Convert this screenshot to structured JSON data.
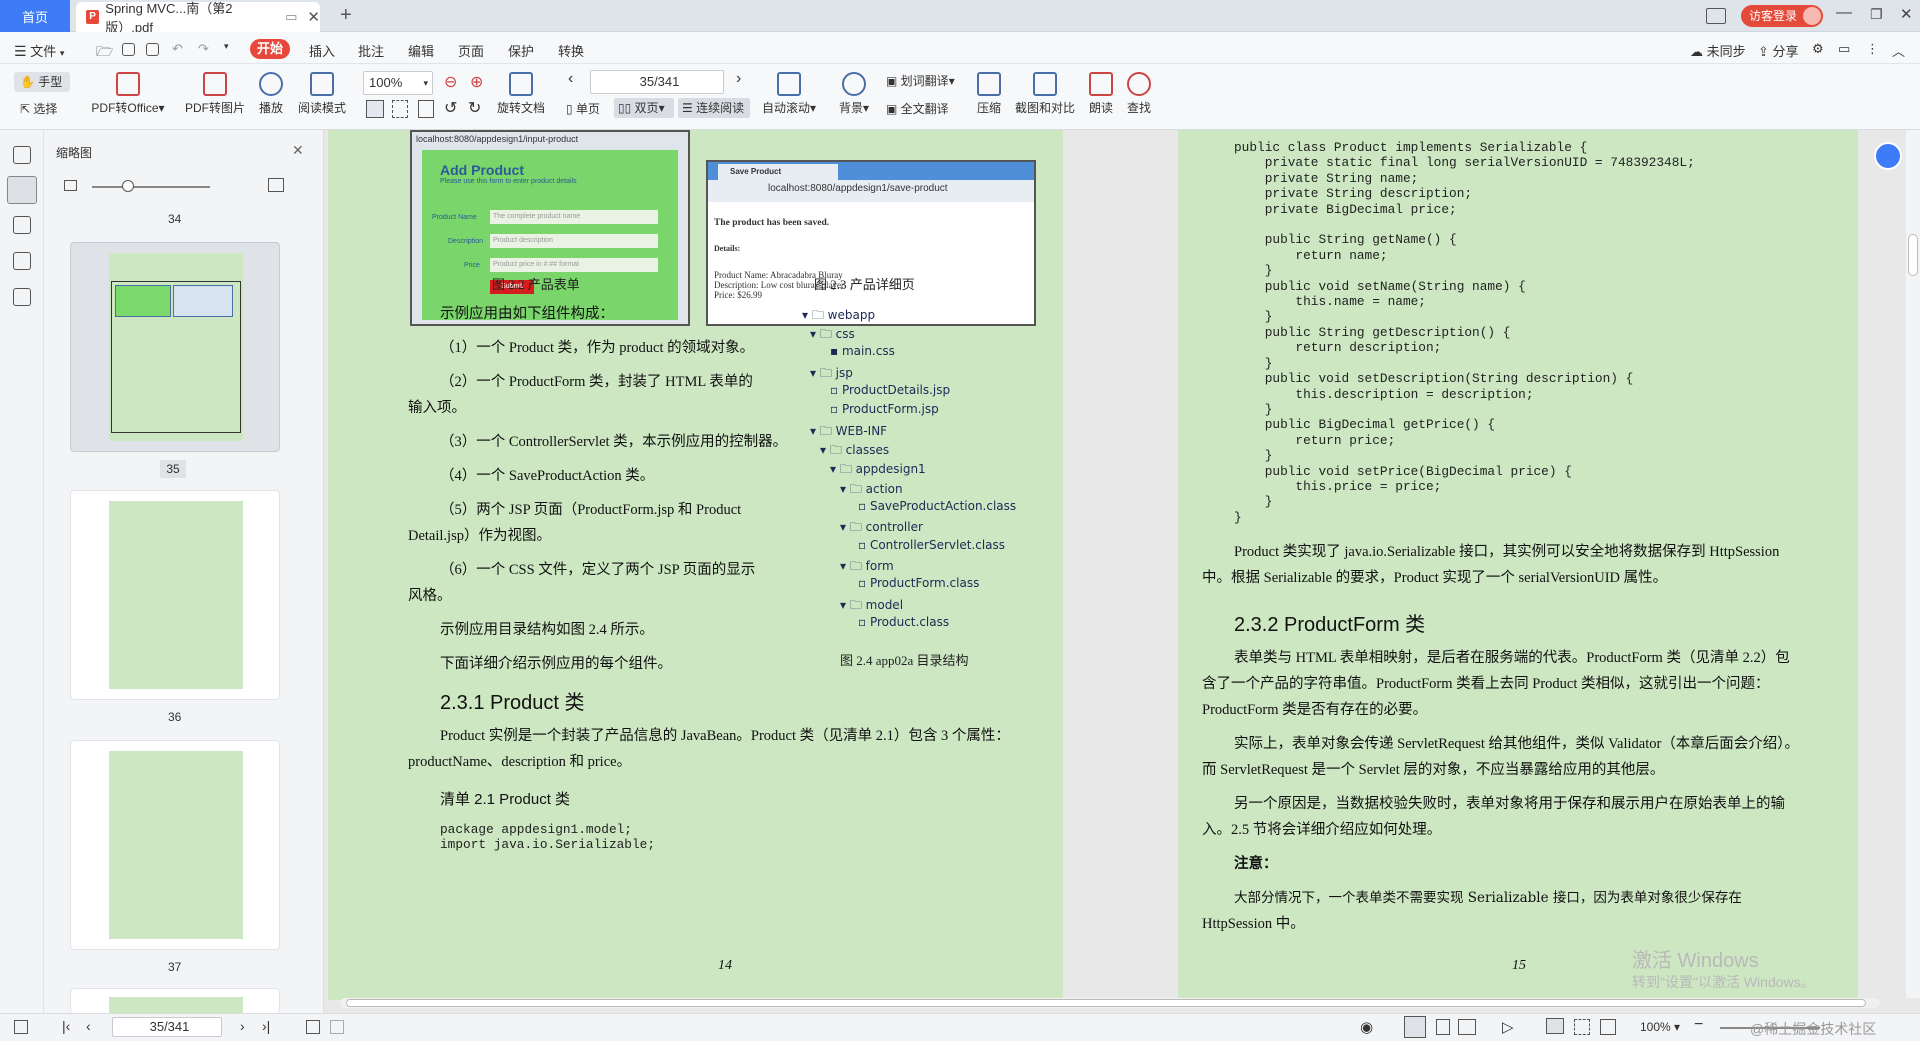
{
  "tabs": {
    "home": "首页",
    "doc": "Spring MVC...南（第2版）.pdf",
    "visitor": "访客登录"
  },
  "menu": {
    "file": "文件",
    "start": "开始",
    "items": [
      "插入",
      "批注",
      "编辑",
      "页面",
      "保护",
      "转换"
    ],
    "unsync": "未同步",
    "share": "分享"
  },
  "toolbar": {
    "hand": "手型",
    "select": "选择",
    "pdf_office": "PDF转Office",
    "pdf_image": "PDF转图片",
    "play": "播放",
    "read_mode": "阅读模式",
    "zoom": "100%",
    "rotate": "旋转文档",
    "page_input": "35/341",
    "single": "单页",
    "double": "双页",
    "continuous": "连续阅读",
    "autoscroll": "自动滚动",
    "background": "背景",
    "word_translate": "划词翻译",
    "full_translate": "全文翻译",
    "compress": "压缩",
    "screenshot_compare": "截图和对比",
    "read_aloud": "朗读",
    "find": "查找"
  },
  "thumbs": {
    "title": "缩略图",
    "pages": [
      "34",
      "35",
      "36",
      "37"
    ]
  },
  "page14": {
    "fig22_caption": "图 2.2 产品表单",
    "fig23_caption": "图 2.3 产品详细页",
    "form": {
      "url": "localhost:8080/appdesign1/input-product",
      "title": "Add Product",
      "subtitle": "Please use this form to enter product details",
      "label_name": "Product Name",
      "label_desc": "Description",
      "label_price": "Price",
      "ph_name": "The complete product name",
      "ph_desc": "Product description",
      "ph_price": "Product price in #.## format",
      "submit": "Submit"
    },
    "detail": {
      "tab": "Save Product",
      "url": "localhost:8080/appdesign1/save-product",
      "saved": "The product has been saved.",
      "details": "Details:",
      "line1": "Product Name: Abracadabra Bluray",
      "line2": "Description: Low cost bluray player",
      "line3": "Price: $26.99"
    },
    "paras": [
      "示例应用由如下组件构成：",
      "（1）一个 Product 类，作为 product 的领域对象。",
      "（2）一个 ProductForm 类，封装了 HTML 表单的",
      "输入项。",
      "（3）一个 ControllerServlet 类，本示例应用的控制器。",
      "（4）一个 SaveProductAction 类。",
      "（5）两个 JSP 页面（ProductForm.jsp 和 Product",
      "Detail.jsp）作为视图。",
      "（6）一个 CSS 文件，定义了两个 JSP 页面的显示",
      "风格。",
      "示例应用目录结构如图 2.4 所示。",
      "下面详细介绍示例应用的每个组件。"
    ],
    "tree": [
      "webapp",
      "css",
      "main.css",
      "jsp",
      "ProductDetails.jsp",
      "ProductForm.jsp",
      "WEB-INF",
      "classes",
      "appdesign1",
      "action",
      "SaveProductAction.class",
      "controller",
      "ControllerServlet.class",
      "form",
      "ProductForm.class",
      "model",
      "Product.class"
    ],
    "fig24_caption": "图 2.4 app02a 目录结构",
    "h231": "2.3.1 Product 类",
    "p231a": "Product 实例是一个封装了产品信息的 JavaBean。Product 类（见清单 2.1）包含 3 个属性：",
    "p231b": "productName、description 和 price。",
    "listing": "清单 2.1 Product 类",
    "code": "package appdesign1.model;\nimport java.io.Serializable;",
    "page_number": "14"
  },
  "page15": {
    "code": "public class Product implements Serializable {\n    private static final long serialVersionUID = 748392348L;\n    private String name;\n    private String description;\n    private BigDecimal price;\n\n    public String getName() {\n        return name;\n    }\n    public void setName(String name) {\n        this.name = name;\n    }\n    public String getDescription() {\n        return description;\n    }\n    public void setDescription(String description) {\n        this.description = description;\n    }\n    public BigDecimal getPrice() {\n        return price;\n    }\n    public void setPrice(BigDecimal price) {\n        this.price = price;\n    }\n}",
    "p1a": "Product 类实现了 java.io.Serializable 接口，其实例可以安全地将数据保存到 HttpSession",
    "p1b": "中。根据 Serializable 的要求，Product 实现了一个 serialVersionUID 属性。",
    "h232": "2.3.2 ProductForm 类",
    "p2a": "表单类与 HTML 表单相映射，是后者在服务端的代表。ProductForm 类（见清单 2.2）包",
    "p2b": "含了一个产品的字符串值。ProductForm 类看上去同 Product 类相似，这就引出一个问题：",
    "p2c": "ProductForm 类是否有存在的必要。",
    "p3a": "实际上，表单对象会传递 ServletRequest 给其他组件，类似 Validator（本章后面会介绍）。",
    "p3b": "而 ServletRequest 是一个 Servlet 层的对象，不应当暴露给应用的其他层。",
    "p4a": "另一个原因是，当数据校验失败时，表单对象将用于保存和展示用户在原始表单上的输",
    "p4b": "入。2.5 节将会详细介绍应如何处理。",
    "note": "注意：",
    "note1": "大部分情况下，一个表单类不需要实现 Serializable 接口，因为表单对象很少保存在",
    "note2": "HttpSession 中。",
    "page_number": "15"
  },
  "status": {
    "page_input": "35/341",
    "zoom": "100%"
  },
  "watermark": {
    "line1": "激活 Windows",
    "line2": "转到\"设置\"以激活 Windows。",
    "credit": "@稀土掘金技术社区"
  }
}
